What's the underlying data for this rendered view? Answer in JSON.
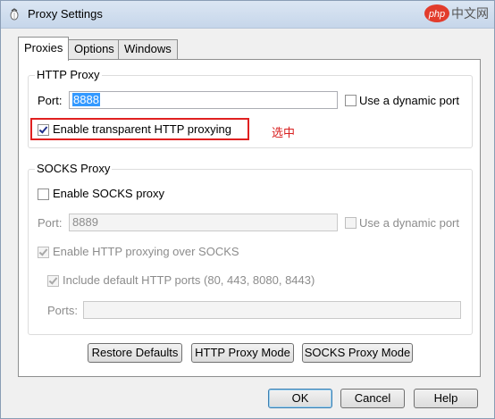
{
  "window": {
    "title": "Proxy Settings"
  },
  "watermark": {
    "brand": "php",
    "text": "中文网"
  },
  "tabs": [
    {
      "label": "Proxies",
      "active": true
    },
    {
      "label": "Options",
      "active": false
    },
    {
      "label": "Windows",
      "active": false
    }
  ],
  "http_proxy": {
    "group_title": "HTTP Proxy",
    "port_label": "Port:",
    "port_value": "8888",
    "dynamic_port_label": "Use a dynamic port",
    "dynamic_port_checked": false,
    "transparent_label": "Enable transparent HTTP proxying",
    "transparent_checked": true
  },
  "annotation": {
    "text": "选中",
    "color": "#d81e1e"
  },
  "socks_proxy": {
    "group_title": "SOCKS Proxy",
    "enable_label": "Enable SOCKS proxy",
    "enable_checked": false,
    "port_label": "Port:",
    "port_value": "8889",
    "dynamic_port_label": "Use a dynamic port",
    "http_over_socks_label": "Enable HTTP proxying over SOCKS",
    "http_over_socks_checked": true,
    "default_ports_label": "Include default HTTP ports (80, 443, 8080, 8443)",
    "default_ports_checked": true,
    "ports_label": "Ports:",
    "ports_value": ""
  },
  "action_buttons": {
    "restore_defaults": "Restore Defaults",
    "http_mode": "HTTP Proxy Mode",
    "socks_mode": "SOCKS Proxy Mode"
  },
  "dialog_buttons": {
    "ok": "OK",
    "cancel": "Cancel",
    "help": "Help"
  },
  "colors": {
    "highlight": "#e02020",
    "selection": "#3399ff",
    "titlebar": "#c6d6ea"
  }
}
